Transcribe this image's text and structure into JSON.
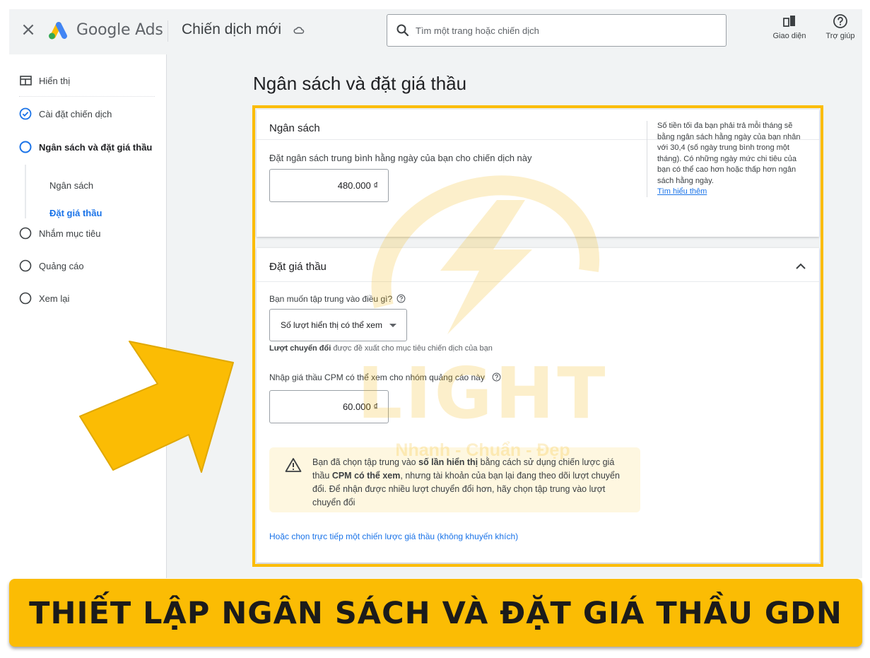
{
  "header": {
    "close_icon": "close-icon",
    "logo_text": "Google Ads",
    "campaign_title": "Chiến dịch mới",
    "search_placeholder": "Tìm một trang hoặc chiến dịch",
    "appearance_label": "Giao diện",
    "help_label": "Trợ giúp"
  },
  "sidebar": {
    "display_label": "Hiển thị",
    "items": [
      {
        "label": "Cài đặt chiến dịch",
        "state": "done"
      },
      {
        "label": "Ngân sách và đặt giá thầu",
        "state": "current"
      },
      {
        "label": "Nhắm mục tiêu",
        "state": "todo"
      },
      {
        "label": "Quảng cáo",
        "state": "todo"
      },
      {
        "label": "Xem lại",
        "state": "todo"
      }
    ],
    "subitems": [
      {
        "label": "Ngân sách",
        "active": false
      },
      {
        "label": "Đặt giá thầu",
        "active": true
      }
    ]
  },
  "main": {
    "title": "Ngân sách và đặt giá thầu",
    "budget": {
      "heading": "Ngân sách",
      "label": "Đặt ngân sách trung bình hằng ngày của bạn cho chiến dịch này",
      "value": "480.000 ₫",
      "note": "Số tiền tối đa bạn phải trả mỗi tháng sẽ bằng ngân sách hằng ngày của bạn nhân với 30,4 (số ngày trung bình trong một tháng). Có những ngày mức chi tiêu của bạn có thể cao hơn hoặc thấp hơn ngân sách hằng ngày.",
      "learn_more": "Tìm hiểu thêm"
    },
    "bidding": {
      "heading": "Đặt giá thầu",
      "focus_label": "Bạn muốn tập trung vào điều gì?",
      "focus_value": "Số lượt hiển thị có thể xem",
      "hint_bold": "Lượt chuyển đổi",
      "hint_rest": " được đề xuất cho mục tiêu chiến dịch của bạn",
      "cpm_label": "Nhập giá thầu CPM có thể xem cho nhóm quảng cáo này",
      "cpm_value": "60.000 ₫",
      "warning": {
        "p1": "Bạn đã chọn tập trung vào ",
        "b1": "số lần hiển thị",
        "p2": " bằng cách sử dụng chiến lược giá thầu ",
        "b2": "CPM có thể xem",
        "p3": ", nhưng tài khoản của bạn lại đang theo dõi lượt chuyển đổi. Để nhận được nhiều lượt chuyển đổi hơn, hãy chọn tập trung vào lượt chuyển đổi"
      },
      "alt_link": "Hoặc chọn trực tiếp một chiến lược giá thầu (không khuyến khích)"
    }
  },
  "watermark": {
    "brand": "LIGHT",
    "slogan": "Nhanh - Chuẩn - Đẹp"
  },
  "banner": {
    "text": "THIẾT LẬP NGÂN SÁCH VÀ ĐẶT GIÁ THẦU GDN"
  },
  "colors": {
    "accent": "#1a73e8",
    "highlight": "#fbbc04",
    "warning_bg": "#fef7e0"
  }
}
